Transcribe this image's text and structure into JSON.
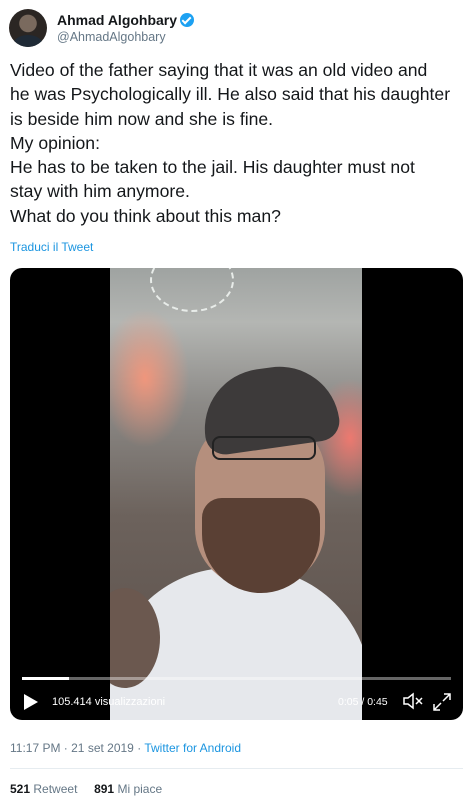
{
  "author": {
    "name": "Ahmad Algohbary",
    "handle": "@AhmadAlgohbary",
    "verified_icon": "verified-badge-icon"
  },
  "tweet": {
    "text": "Video of the father saying that it was an old video and\nhe was Psychologically ill. He also said that his daughter\nis beside him now and she is fine.\nMy opinion:\nHe has to be taken to the jail. His daughter must not\nstay with him anymore.\nWhat do you think about this man?",
    "translate_link": "Traduci il Tweet"
  },
  "video": {
    "views": "105.414 visualizzazioni",
    "time": "0:05 / 0:45",
    "progress": 0.11,
    "icons": [
      "play-icon",
      "mute-icon",
      "fullscreen-icon"
    ]
  },
  "meta": {
    "timestamp": "11:17 PM · 21 set 2019",
    "separator": " · ",
    "source": "Twitter for Android"
  },
  "stats": {
    "retweets_count": "521",
    "retweets_label": "Retweet",
    "likes_count": "891",
    "likes_label": "Mi piace"
  },
  "colors": {
    "link": "#1b95e0",
    "verified": "#1da1f2",
    "muted": "#657786"
  }
}
